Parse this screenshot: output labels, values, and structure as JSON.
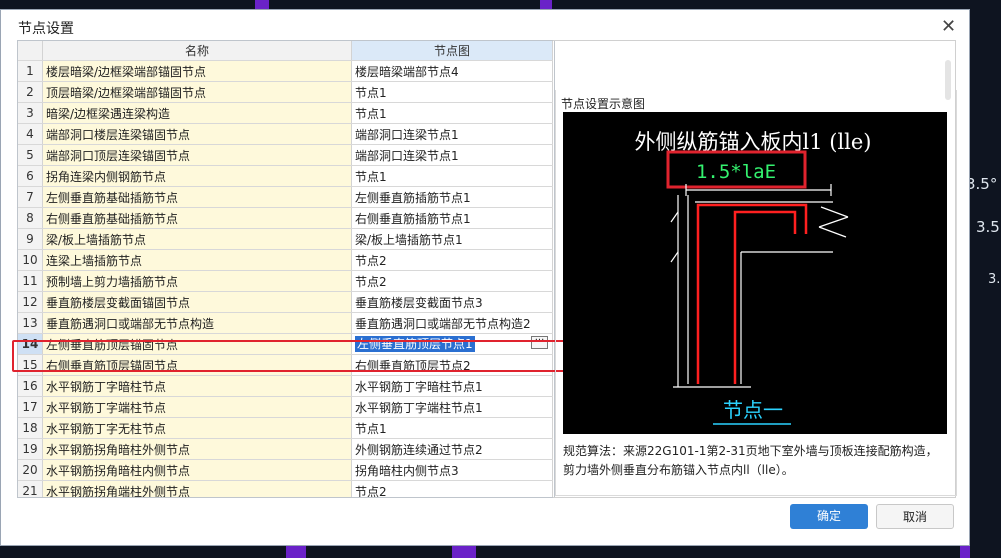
{
  "dialog_title": "节点设置",
  "columns": [
    "名称",
    "节点图"
  ],
  "rows": [
    {
      "num": "1",
      "name": "楼层暗梁/边框梁端部锚固节点",
      "node": "楼层暗梁端部节点4"
    },
    {
      "num": "2",
      "name": "顶层暗梁/边框梁端部锚固节点",
      "node": "节点1"
    },
    {
      "num": "3",
      "name": "暗梁/边框梁遇连梁构造",
      "node": "节点1"
    },
    {
      "num": "4",
      "name": "端部洞口楼层连梁锚固节点",
      "node": "端部洞口连梁节点1"
    },
    {
      "num": "5",
      "name": "端部洞口顶层连梁锚固节点",
      "node": "端部洞口连梁节点1"
    },
    {
      "num": "6",
      "name": "拐角连梁内侧钢筋节点",
      "node": "节点1"
    },
    {
      "num": "7",
      "name": "左侧垂直筋基础插筋节点",
      "node": "左侧垂直筋插筋节点1"
    },
    {
      "num": "8",
      "name": "右侧垂直筋基础插筋节点",
      "node": "右侧垂直筋插筋节点1"
    },
    {
      "num": "9",
      "name": "梁/板上墙插筋节点",
      "node": "梁/板上墙插筋节点1"
    },
    {
      "num": "10",
      "name": "连梁上墙插筋节点",
      "node": "节点2"
    },
    {
      "num": "11",
      "name": "预制墙上剪力墙插筋节点",
      "node": "节点2"
    },
    {
      "num": "12",
      "name": "垂直筋楼层变截面锚固节点",
      "node": "垂直筋楼层变截面节点3"
    },
    {
      "num": "13",
      "name": "垂直筋遇洞口或端部无节点构造",
      "node": "垂直筋遇洞口或端部无节点构造2"
    },
    {
      "num": "14",
      "name": "左侧垂直筋顶层锚固节点",
      "node": "左侧垂直筋顶层节点1",
      "selected": true
    },
    {
      "num": "15",
      "name": "右侧垂直筋顶层锚固节点",
      "node": "右侧垂直筋顶层节点2"
    },
    {
      "num": "16",
      "name": "水平钢筋丁字暗柱节点",
      "node": "水平钢筋丁字暗柱节点1"
    },
    {
      "num": "17",
      "name": "水平钢筋丁字端柱节点",
      "node": "水平钢筋丁字端柱节点1"
    },
    {
      "num": "18",
      "name": "水平钢筋丁字无柱节点",
      "node": "节点1"
    },
    {
      "num": "19",
      "name": "水平钢筋拐角暗柱外侧节点",
      "node": "外侧钢筋连续通过节点2"
    },
    {
      "num": "20",
      "name": "水平钢筋拐角暗柱内侧节点",
      "node": "拐角暗柱内侧节点3"
    },
    {
      "num": "21",
      "name": "水平钢筋拐角端柱外侧节点",
      "node": "节点2"
    }
  ],
  "preview": {
    "label": "节点设置示意图",
    "diagram_title": "外侧纵筋锚入板内l1 (lle)",
    "diagram_formula": "1.5*laE",
    "diagram_caption": "节点一",
    "description": "规范算法：来源22G101-1第2-31页地下室外墙与顶板连接配筋构造，剪力墙外侧垂直分布筋锚入节点内ll（lle）。"
  },
  "buttons": {
    "ok": "确定",
    "cancel": "取消"
  },
  "background_labels": [
    "3.5°",
    "3.5",
    "3."
  ],
  "colors": {
    "accent": "#2f80d6",
    "highlight": "#e0232e",
    "name_cell": "#fef9db",
    "background_block": "#6a22c8"
  }
}
